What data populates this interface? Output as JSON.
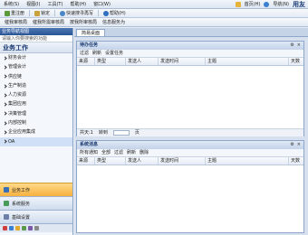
{
  "menubar": {
    "items": [
      "系统(S)",
      "视图(I)",
      "工具(T)",
      "帮助(H)",
      "窗口(W)"
    ],
    "right_items": [
      "首页(H)",
      "导航(N)"
    ],
    "brand": "用友"
  },
  "toolbar1": {
    "buttons": [
      "重注册",
      "锁定",
      "快速搜寻再写",
      "帮助(H)"
    ]
  },
  "toolbar2": {
    "items": [
      "催我审核局",
      "催我所需审核局",
      "按我所审核局",
      "信息服务为"
    ]
  },
  "sidebar": {
    "header": "业务导航视图",
    "search_placeholder": "请输入你要搜索的功能",
    "title": "业务工作",
    "tree": [
      "财务会计",
      "管理会计",
      "供应链",
      "生产制造",
      "人力资源",
      "集团应用",
      "决策管理",
      "内部控制",
      "企业应用集成",
      "OA"
    ],
    "selected_index": 9,
    "nav_buttons": [
      "业务工作",
      "系统服务",
      "基础设置"
    ],
    "active_nav": 0
  },
  "main": {
    "tab": "简易桌面",
    "panels": [
      {
        "title": "待办任务",
        "toolbar": [
          "过滤",
          "刷新",
          "设置任务"
        ],
        "columns": [
          "来源",
          "类型",
          "发送人",
          "发送时间",
          "主题",
          "天数"
        ],
        "pager": {
          "count_label": "共天:1",
          "jump_label": "转到",
          "page_label": "页"
        }
      },
      {
        "title": "系统消息",
        "toolbar": [
          "所有通知",
          "全部",
          "过滤",
          "刷新",
          "删除"
        ],
        "columns": [
          "来源",
          "类型",
          "发送人",
          "发送时间",
          "主题",
          "天数"
        ]
      }
    ]
  },
  "colors": {
    "accent": "#2a5595",
    "active_nav": "#f7b13e",
    "panel_border": "#8ea6c8"
  }
}
